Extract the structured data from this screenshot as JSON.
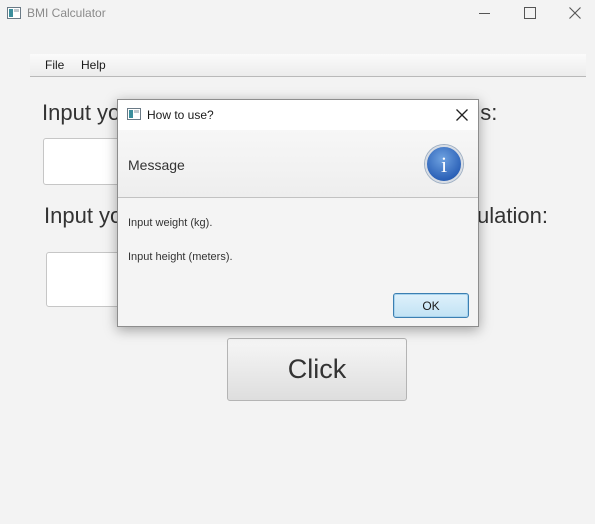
{
  "window": {
    "title": "BMI Calculator",
    "controls": {
      "minimize": "minimize-icon",
      "maximize": "maximize-icon",
      "close": "close-icon"
    }
  },
  "menu": {
    "items": [
      {
        "label": "File"
      },
      {
        "label": "Help"
      }
    ]
  },
  "main": {
    "weight_label": {
      "visible_start": "Input yo",
      "visible_end": "us:"
    },
    "weight_input": {
      "value": ""
    },
    "height_label": {
      "visible_start": "Input yo",
      "visible_end": "ulation:"
    },
    "height_input": {
      "value": ""
    },
    "click_button": "Click"
  },
  "dialog": {
    "title": "How to use?",
    "header": "Message",
    "icon": "info-icon",
    "info_glyph": "i",
    "lines": [
      "Input weight (kg).",
      "Input height (meters)."
    ],
    "ok_button": "OK"
  },
  "colors": {
    "background": "#f3f3f3",
    "info_icon": "#2c62b8",
    "ok_button_border": "#3c7fb1"
  }
}
